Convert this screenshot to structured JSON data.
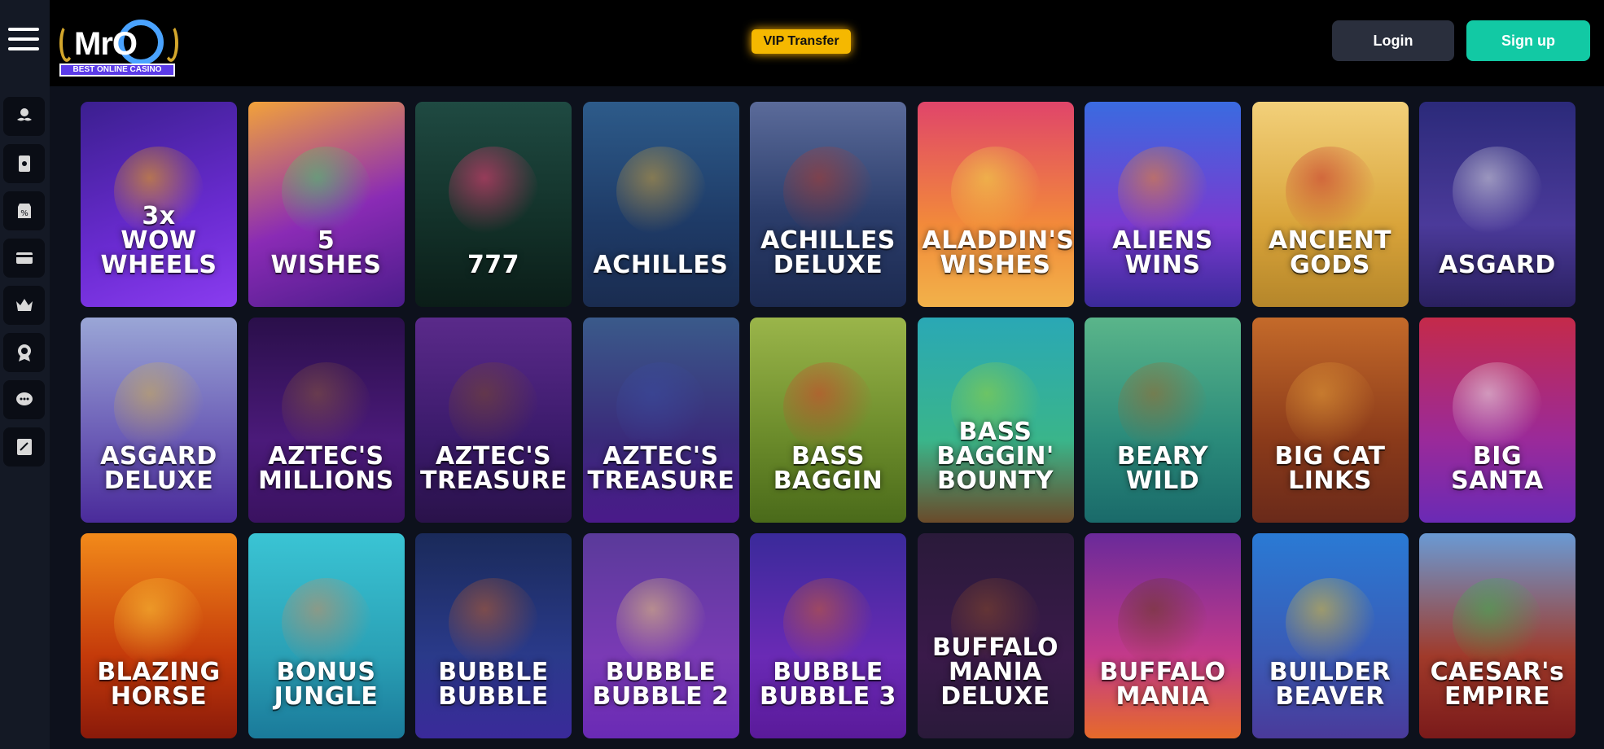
{
  "header": {
    "logo_text": "MrO",
    "logo_tagline": "BEST ONLINE CASINO",
    "vip_label": "VIP Transfer",
    "login_label": "Login",
    "signup_label": "Sign up"
  },
  "sidebar": {
    "items": [
      {
        "icon": "mustache-icon"
      },
      {
        "icon": "cards-icon"
      },
      {
        "icon": "promo-tag-icon"
      },
      {
        "icon": "credit-card-icon"
      },
      {
        "icon": "crown-icon"
      },
      {
        "icon": "badge-icon"
      },
      {
        "icon": "live-chat-icon"
      },
      {
        "icon": "notepad-icon"
      }
    ]
  },
  "games": [
    {
      "title": "3x\nWOW\nWHEELS",
      "bg": "linear-gradient(160deg,#3b1f8f,#6a2bd1 60%,#8a3cf0)",
      "art": "#ffb300"
    },
    {
      "title": "5\nWISHES",
      "bg": "linear-gradient(160deg,#f2a23a,#8a2bb5 55%,#4b1c8a)",
      "art": "#3bd46a"
    },
    {
      "title": "777",
      "bg": "linear-gradient(180deg,#1f4a42,#123028 60%,#0b1d18)",
      "art": "#ff3d7a"
    },
    {
      "title": "ACHILLES",
      "bg": "linear-gradient(180deg,#2d5b8a,#1e3a66 60%,#1a2c50)",
      "art": "#d4a43a"
    },
    {
      "title": "ACHILLES\nDELUXE",
      "bg": "linear-gradient(180deg,#5b6b9a,#2b3d6b 55%,#1c2a50)",
      "art": "#b33a2a"
    },
    {
      "title": "ALADDIN'S\nWISHES",
      "bg": "linear-gradient(180deg,#e0456a,#f28a3a 60%,#f2b24a)",
      "art": "#f2e24a"
    },
    {
      "title": "ALIENS\nWINS",
      "bg": "linear-gradient(180deg,#3a6be0,#7a3ad0 60%,#3b2a9a)",
      "art": "#ff8a1a"
    },
    {
      "title": "ANCIENT\nGODS",
      "bg": "linear-gradient(180deg,#f2d07a,#d9a43a 60%,#b5862a)",
      "art": "#c42a2a"
    },
    {
      "title": "ASGARD",
      "bg": "linear-gradient(180deg,#2b2a7a,#4b3a9a 60%,#2a2060)",
      "art": "#e6e6e6"
    },
    {
      "title": "ASGARD\nDELUXE",
      "bg": "linear-gradient(180deg,#9aa6d6,#6a5ab5 60%,#4a2b9a)",
      "art": "#d4b24a"
    },
    {
      "title": "AZTEC'S\nMILLIONS",
      "bg": "linear-gradient(180deg,#2a0f4a,#4b1a7a 60%,#3a1260)",
      "art": "#8a5a3a"
    },
    {
      "title": "AZTEC'S\nTREASURE",
      "bg": "linear-gradient(180deg,#5a2a8a,#3a1a6a 60%,#2a124a)",
      "art": "#7a4a2a"
    },
    {
      "title": "AZTEC'S\nTREASURE",
      "bg": "linear-gradient(180deg,#3a5a8a,#3a2a7a 60%,#4a1a8a)",
      "art": "#3a4aa0"
    },
    {
      "title": "BASS\nBAGGIN",
      "bg": "linear-gradient(180deg,#9ab54a,#6a8a2a 60%,#4a6a1a)",
      "art": "#d43a2a"
    },
    {
      "title": "BASS\nBAGGIN'\nBOUNTY",
      "bg": "linear-gradient(180deg,#2aa8b5,#3ab58a 60%,#6a4a2a)",
      "art": "#9ad43a"
    },
    {
      "title": "BEARY\nWILD",
      "bg": "linear-gradient(180deg,#5ab58a,#2a8a7a 60%,#1a6a6a)",
      "art": "#a0652a"
    },
    {
      "title": "BIG CAT\nLINKS",
      "bg": "linear-gradient(180deg,#c46a2a,#8a3a1a 60%,#6a2a1a)",
      "art": "#e6a03a"
    },
    {
      "title": "BIG\nSANTA",
      "bg": "linear-gradient(180deg,#c42a4a,#9a2a9a 60%,#6a2ab5)",
      "art": "#f2f2f2"
    },
    {
      "title": "BLAZING\nHORSE",
      "bg": "linear-gradient(180deg,#f28a1a,#c43a0a 60%,#8a1a0a)",
      "art": "#ffcc3a"
    },
    {
      "title": "BONUS\nJUNGLE",
      "bg": "linear-gradient(180deg,#3ac4d4,#2aa0b5 60%,#1a7a9a)",
      "art": "#d48a5a"
    },
    {
      "title": "BUBBLE\nBUBBLE",
      "bg": "linear-gradient(180deg,#1a2a5a,#2a3a8a 60%,#3a2a9a)",
      "art": "#c4602a"
    },
    {
      "title": "BUBBLE\nBUBBLE 2",
      "bg": "linear-gradient(180deg,#5a3a9a,#7a3ab5 60%,#6a2ab5)",
      "art": "#f2d07a"
    },
    {
      "title": "BUBBLE\nBUBBLE 3",
      "bg": "linear-gradient(180deg,#3a2a9a,#6a2ab5 60%,#5a1a9a)",
      "art": "#d4602a"
    },
    {
      "title": "BUFFALO\nMANIA\nDELUXE",
      "bg": "linear-gradient(180deg,#2a1a3a,#3a1a4a 60%,#2a1a3a)",
      "art": "#8a4a2a"
    },
    {
      "title": "BUFFALO\nMANIA",
      "bg": "linear-gradient(180deg,#6a2a9a,#c43a8a 60%,#e66a2a)",
      "art": "#6a3a1a"
    },
    {
      "title": "BUILDER\nBEAVER",
      "bg": "linear-gradient(180deg,#2a7ad4,#3a5ab5 60%,#4a3a9a)",
      "art": "#f2c42a"
    },
    {
      "title": "CAESAR's\nEMPIRE",
      "bg": "linear-gradient(180deg,#6a9ad4,#a03a2a 60%,#7a1a1a)",
      "art": "#3ab54a"
    }
  ]
}
